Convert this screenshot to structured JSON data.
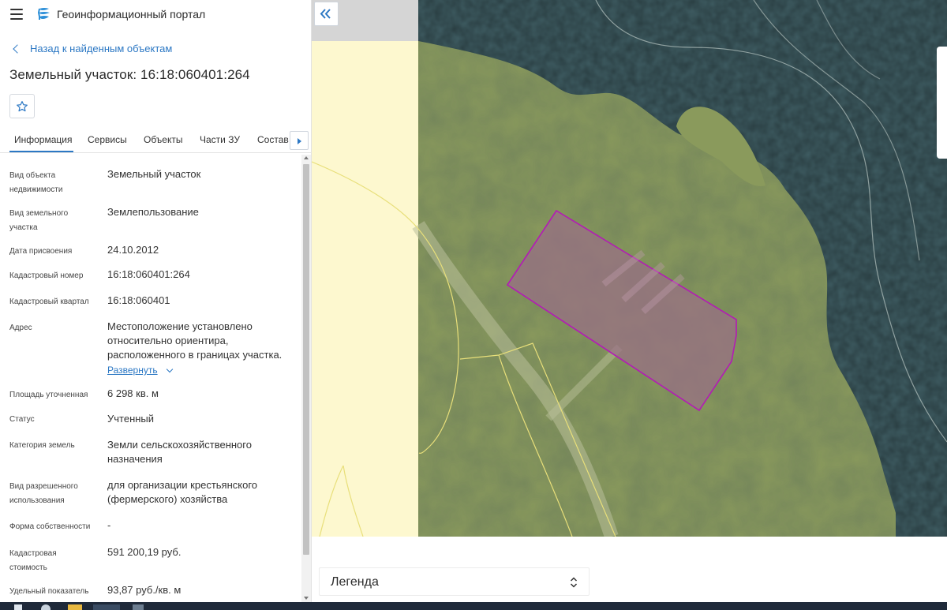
{
  "header": {
    "app_title": "Геоинформационный портал"
  },
  "back_link": "Назад к найденным объектам",
  "object_title": "Земельный участок: 16:18:060401:264",
  "tabs": [
    {
      "label": "Информация",
      "active": true
    },
    {
      "label": "Сервисы"
    },
    {
      "label": "Объекты"
    },
    {
      "label": "Части ЗУ"
    },
    {
      "label": "Состав"
    }
  ],
  "properties": [
    {
      "label": "Вид объекта недвижимости",
      "value": "Земельный участок"
    },
    {
      "label": "Вид земельного участка",
      "value": "Землепользование"
    },
    {
      "label": "Дата присвоения",
      "value": "24.10.2012"
    },
    {
      "label": "Кадастровый номер",
      "value": "16:18:060401:264"
    },
    {
      "label": "Кадастровый квартал",
      "value": "16:18:060401"
    },
    {
      "label": "Адрес",
      "value": "Местоположение установлено относительно ориентира, расположенного в границах участка."
    },
    {
      "label": "Площадь уточненная",
      "value": "6 298 кв. м"
    },
    {
      "label": "Статус",
      "value": "Учтенный"
    },
    {
      "label": "Категория земель",
      "value": "Земли сельскохозяйственного назначения"
    },
    {
      "label": "Вид разрешенного использования",
      "value": "для организации крестьянского (фермерского) хозяйства"
    },
    {
      "label": "Форма собственности",
      "value": "-"
    },
    {
      "label": "Кадастровая стоимость",
      "value": "591 200,19 руб."
    },
    {
      "label": "Удельный показатель",
      "value": "93,87 руб./кв. м"
    }
  ],
  "expand_link": "Развернуть",
  "legend": {
    "label": "Легенда"
  },
  "icons": {
    "menu": "hamburger-icon",
    "logo": "portal-logo",
    "back": "chevron-left-icon",
    "favorite": "star-outline-icon",
    "tabs_next": "arrow-right-icon",
    "collapse": "double-chevron-left-icon",
    "legend_toggle": "updown-chevron-icon"
  },
  "colors": {
    "accent": "#2c78c4",
    "parcel_outline": "#b31bb5",
    "parcel_fill": "#9a6f86",
    "boundary_lines": "#e8df7a",
    "land": "#8a9a5c",
    "water": "#3f5d63",
    "cream_zone": "#fdf8cf"
  }
}
